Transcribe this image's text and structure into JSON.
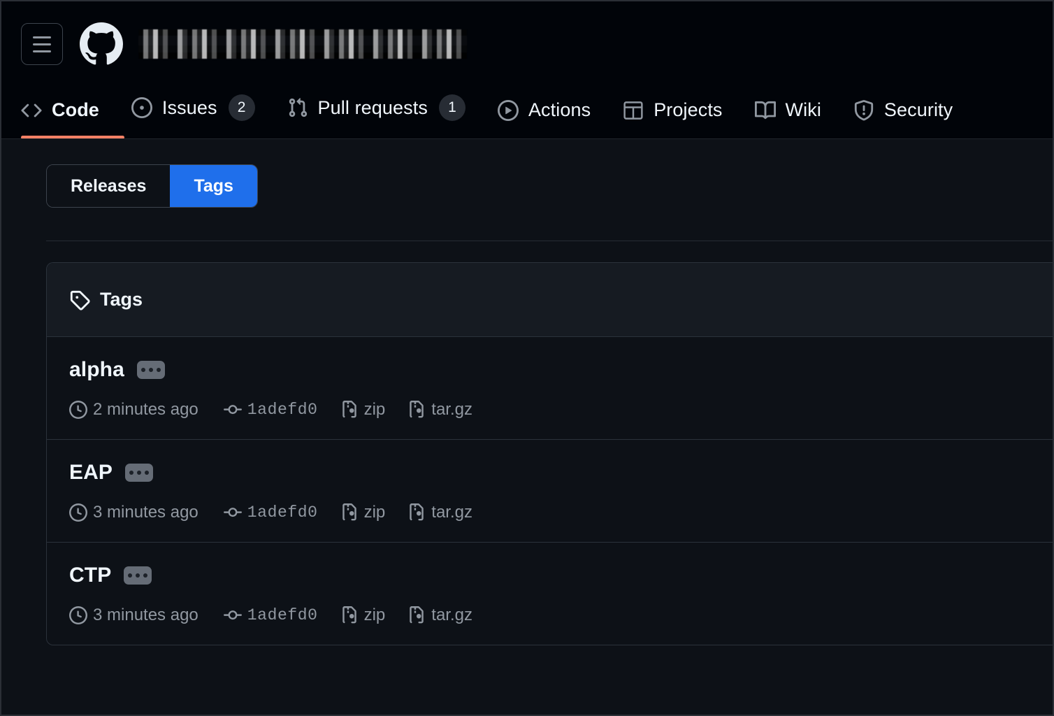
{
  "header": {
    "menu_button": "menu-icon",
    "logo": "github-logo",
    "repo_title": "",
    "repo_title_state": "redacted",
    "nav": [
      {
        "label": "Code",
        "icon": "code-icon",
        "count": null,
        "selected": true
      },
      {
        "label": "Issues",
        "icon": "issue-icon",
        "count": "2",
        "selected": false
      },
      {
        "label": "Pull requests",
        "icon": "git-pull-request-icon",
        "count": "1",
        "selected": false
      },
      {
        "label": "Actions",
        "icon": "play-icon",
        "count": null,
        "selected": false
      },
      {
        "label": "Projects",
        "icon": "table-icon",
        "count": null,
        "selected": false
      },
      {
        "label": "Wiki",
        "icon": "book-icon",
        "count": null,
        "selected": false
      },
      {
        "label": "Security",
        "icon": "shield-icon",
        "count": null,
        "selected": false
      }
    ],
    "active_tab_color": "#f78166"
  },
  "toggle": {
    "releases_label": "Releases",
    "tags_label": "Tags",
    "selected": "Tags",
    "selected_color": "#1f6feb"
  },
  "panel": {
    "title": "Tags",
    "icon": "tag-icon",
    "rows": [
      {
        "name": "alpha",
        "menu": "kebab-menu",
        "time": "2 minutes ago",
        "time_icon": "clock-icon",
        "commit": "1adefd0",
        "commit_icon": "git-commit-icon",
        "zip_label": "zip",
        "zip_icon": "file-zip-icon",
        "targz_label": "tar.gz",
        "targz_icon": "file-zip-icon"
      },
      {
        "name": "EAP",
        "menu": "kebab-menu",
        "time": "3 minutes ago",
        "time_icon": "clock-icon",
        "commit": "1adefd0",
        "commit_icon": "git-commit-icon",
        "zip_label": "zip",
        "zip_icon": "file-zip-icon",
        "targz_label": "tar.gz",
        "targz_icon": "file-zip-icon"
      },
      {
        "name": "CTP",
        "menu": "kebab-menu",
        "time": "3 minutes ago",
        "time_icon": "clock-icon",
        "commit": "1adefd0",
        "commit_icon": "git-commit-icon",
        "zip_label": "zip",
        "zip_icon": "file-zip-icon",
        "targz_label": "tar.gz",
        "targz_icon": "file-zip-icon"
      }
    ]
  }
}
